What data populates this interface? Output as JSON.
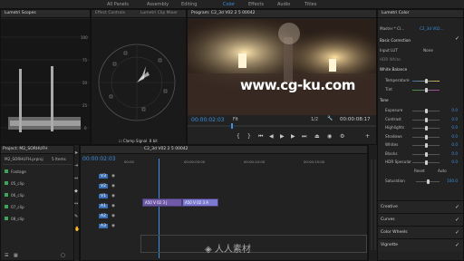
{
  "workspaces": [
    "All Panels",
    "Assembly",
    "Editing",
    "Color",
    "Effects",
    "Audio",
    "Titles"
  ],
  "active_workspace": "Color",
  "scopes": {
    "wave_tab": "Lumetri Scopes",
    "vec_tabs": [
      "Effect Controls",
      "Lumetri Clip Mixer"
    ]
  },
  "program": {
    "tab": "Program: C2_3d V02 2 5 00042",
    "timecode_left": "00:00:02:03",
    "fit": "Fit",
    "ratio": "1/2",
    "timecode_right": "00:00:08:17",
    "watermark": "www.cg-ku.com"
  },
  "lumetri": {
    "tab": "Lumetri Color",
    "master": "Master * Cl...",
    "sequence": "C2_3d V02...",
    "basic": "Basic Correction",
    "input_lut": "Input LUT",
    "lut_value": "None",
    "hdr_white": "HDR White",
    "white_balance": "White Balance",
    "temperature": "Temperature",
    "tint": "Tint",
    "tone": "Tone",
    "rows": [
      {
        "label": "Exposure",
        "value": "0.0",
        "pos": 0.5
      },
      {
        "label": "Contrast",
        "value": "0.0",
        "pos": 0.5
      },
      {
        "label": "Highlights",
        "value": "0.0",
        "pos": 0.5
      },
      {
        "label": "Shadows",
        "value": "0.0",
        "pos": 0.5
      },
      {
        "label": "Whites",
        "value": "0.0",
        "pos": 0.5
      },
      {
        "label": "Blacks",
        "value": "0.0",
        "pos": 0.5
      },
      {
        "label": "HDR Specular",
        "value": "0.0",
        "pos": 0.5
      }
    ],
    "reset": "Reset",
    "auto": "Auto",
    "saturation": "Saturation",
    "saturation_value": "100.0",
    "sections": [
      "Creative",
      "Curves",
      "Color Wheels",
      "Vignette"
    ]
  },
  "project": {
    "tab": "Project: M2_SORHUFH",
    "file": "M2_SORHUFH.prproj",
    "count": "5 Items",
    "items": [
      "Footage",
      "05_clip",
      "06_clip",
      "07_clip",
      "08_clip"
    ]
  },
  "timeline": {
    "tab": "C2_3d V02 2 5 00042",
    "timecode": "00:00:02:03",
    "ruler": [
      "00:00",
      "00:00:05:00",
      "00:00:10:00",
      "00:00:15:00"
    ],
    "tracks": [
      "V3",
      "V2",
      "V1",
      "A1",
      "A2",
      "A3"
    ],
    "clips": [
      "A50 V 02 3 J",
      "A50 V 02 3 A"
    ]
  },
  "colors": {
    "accent": "#3d8fe0",
    "clip_purple": "#6f5aa8",
    "clip_blue": "#3b6fb6"
  }
}
